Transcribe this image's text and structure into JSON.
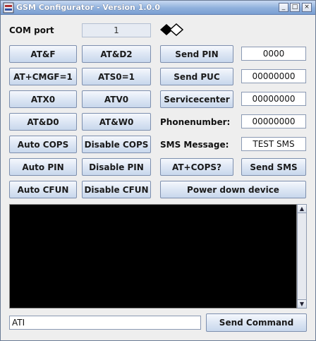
{
  "window": {
    "title": "GSM Configurator - Version 1.0.0",
    "controls": {
      "minimize": "_",
      "maximize": "□",
      "close": "×"
    }
  },
  "com": {
    "label": "COM port",
    "value": "1",
    "icon": "diamond-logo-icon"
  },
  "at_buttons": {
    "at_f": "AT&F",
    "at_d2": "AT&D2",
    "at_cmgf": "AT+CMGF=1",
    "ats0": "ATS0=1",
    "atx0": "ATX0",
    "atv0": "ATV0",
    "at_d0": "AT&D0",
    "at_w0": "AT&W0",
    "auto_cops": "Auto COPS",
    "disable_cops": "Disable COPS",
    "auto_pin": "Auto PIN",
    "disable_pin": "Disable PIN",
    "auto_cfun": "Auto CFUN",
    "disable_cfun": "Disable CFUN"
  },
  "right_panel": {
    "send_pin": {
      "label": "Send PIN",
      "value": "0000"
    },
    "send_puc": {
      "label": "Send PUC",
      "value": "00000000"
    },
    "servicecenter": {
      "label": "Servicecenter",
      "value": "00000000"
    },
    "phonenumber": {
      "label": "Phonenumber:",
      "value": "00000000"
    },
    "sms_message": {
      "label": "SMS Message:",
      "value": "TEST SMS"
    },
    "at_cops_q": "AT+COPS?",
    "send_sms": "Send SMS",
    "power_down": "Power down device"
  },
  "command": {
    "value": "ATI",
    "send_label": "Send Command"
  },
  "colors": {
    "terminal_bg": "#000000",
    "button_border": "#7d8fae",
    "titlebar": "#8fb0dc"
  }
}
